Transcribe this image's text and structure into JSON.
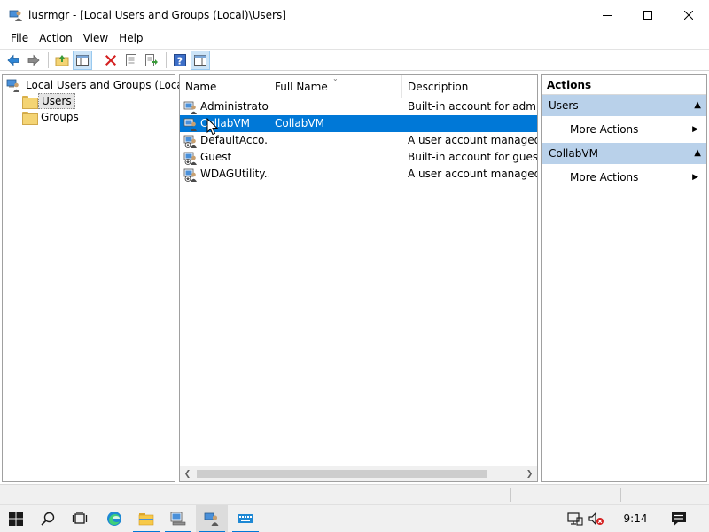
{
  "window": {
    "title": "lusrmgr - [Local Users and Groups (Local)\\Users]",
    "controls": {
      "minimize": "minimize",
      "maximize": "maximize",
      "close": "close"
    }
  },
  "menu": [
    "File",
    "Action",
    "View",
    "Help"
  ],
  "toolbar": {
    "buttons": [
      "back-icon",
      "forward-icon",
      "up-folder-icon",
      "show-hide-tree-icon",
      "delete-icon",
      "properties-icon",
      "export-list-icon",
      "help-icon",
      "show-hide-action-pane-icon"
    ]
  },
  "tree": {
    "root": "Local Users and Groups (Local)",
    "children": [
      "Users",
      "Groups"
    ],
    "selected": "Users"
  },
  "list": {
    "columns": [
      "Name",
      "Full Name",
      "Description"
    ],
    "rows": [
      {
        "name": "Administrator",
        "full_name": "",
        "description": "Built-in account for adminis"
      },
      {
        "name": "CollabVM",
        "full_name": "CollabVM",
        "description": ""
      },
      {
        "name": "DefaultAcco...",
        "full_name": "",
        "description": "A user account managed by"
      },
      {
        "name": "Guest",
        "full_name": "",
        "description": "Built-in account for guest ac"
      },
      {
        "name": "WDAGUtility...",
        "full_name": "",
        "description": "A user account managed ar"
      }
    ],
    "selected_row": 1
  },
  "actions": {
    "header": "Actions",
    "sections": [
      {
        "title": "Users",
        "items": [
          "More Actions"
        ]
      },
      {
        "title": "CollabVM",
        "items": [
          "More Actions"
        ]
      }
    ]
  },
  "taskbar": {
    "apps": [
      "start-icon",
      "search-icon",
      "task-view-icon",
      "edge-icon",
      "file-explorer-icon",
      "computer-management-icon",
      "lusrmgr-icon",
      "keyboard-icon"
    ],
    "clock": "9:14 AM"
  },
  "colors": {
    "selection": "#0078d7",
    "action_section": "#b9d1ea",
    "taskbar_indicator": "#0078d7"
  }
}
